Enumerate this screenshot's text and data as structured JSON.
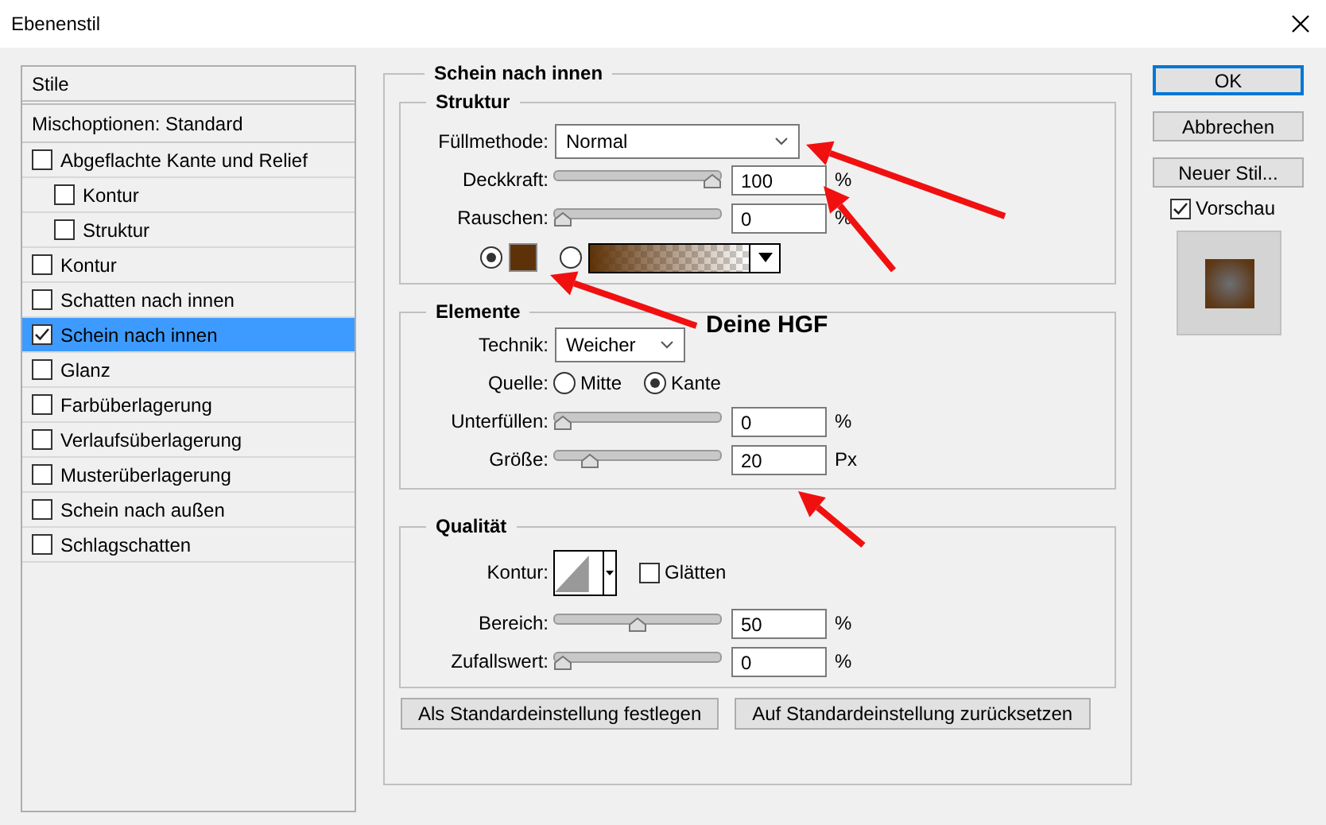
{
  "window": {
    "title": "Ebenenstil"
  },
  "styles_list": {
    "header": "Stile",
    "blend_options": "Mischoptionen: Standard",
    "items": [
      {
        "label": "Abgeflachte Kante und Relief",
        "checked": false,
        "selected": false,
        "children": [
          {
            "label": "Kontur",
            "checked": false,
            "selected": false
          },
          {
            "label": "Struktur",
            "checked": false,
            "selected": false
          }
        ]
      },
      {
        "label": "Kontur",
        "checked": false,
        "selected": false
      },
      {
        "label": "Schatten nach innen",
        "checked": false,
        "selected": false
      },
      {
        "label": "Schein nach innen",
        "checked": true,
        "selected": true
      },
      {
        "label": "Glanz",
        "checked": false,
        "selected": false
      },
      {
        "label": "Farbüberlagerung",
        "checked": false,
        "selected": false
      },
      {
        "label": "Verlaufsüberlagerung",
        "checked": false,
        "selected": false
      },
      {
        "label": "Musterüberlagerung",
        "checked": false,
        "selected": false
      },
      {
        "label": "Schein nach außen",
        "checked": false,
        "selected": false
      },
      {
        "label": "Schlagschatten",
        "checked": false,
        "selected": false
      }
    ]
  },
  "panel": {
    "title": "Schein nach innen",
    "structure": {
      "title": "Struktur",
      "blend_mode": {
        "label": "Füllmethode:",
        "value": "Normal"
      },
      "sliders": [
        {
          "label": "Deckkraft:",
          "level": 1,
          "value": "100",
          "unit": "%"
        },
        {
          "label": "Rauschen:",
          "level": 0,
          "value": "0",
          "unit": "%"
        }
      ],
      "fill_type": [
        {
          "kind": "solid",
          "selected": true
        },
        {
          "kind": "gradient",
          "selected": false
        }
      ]
    },
    "elements": {
      "title": "Elemente",
      "technique": {
        "label": "Technik:",
        "value": "Weicher"
      },
      "source": {
        "label": "Quelle:",
        "options": [
          {
            "label": "Mitte",
            "selected": false
          },
          {
            "label": "Kante",
            "selected": true
          }
        ]
      },
      "sliders": [
        {
          "label": "Unterfüllen:",
          "level": 0,
          "value": "0",
          "unit": "%"
        },
        {
          "label": "Größe:",
          "level": 0.18,
          "value": "20",
          "unit": "Px"
        }
      ]
    },
    "quality": {
      "title": "Qualität",
      "contour_label": "Kontur:",
      "antialias": {
        "label": "Glätten",
        "checked": false
      },
      "sliders": [
        {
          "label": "Bereich:",
          "level": 0.5,
          "value": "50",
          "unit": "%"
        },
        {
          "label": "Zufallswert:",
          "level": 0,
          "value": "0",
          "unit": "%"
        }
      ]
    },
    "buttons": [
      "Als Standardeinstellung festlegen",
      "Auf Standardeinstellung zurücksetzen"
    ]
  },
  "actions": [
    {
      "label": "OK",
      "default": true
    },
    {
      "label": "Abbrechen",
      "default": false
    },
    {
      "label": "Neuer Stil...",
      "default": false
    }
  ],
  "preview": {
    "label": "Vorschau",
    "checked": true
  },
  "annotation": {
    "text": "Deine HGF"
  }
}
